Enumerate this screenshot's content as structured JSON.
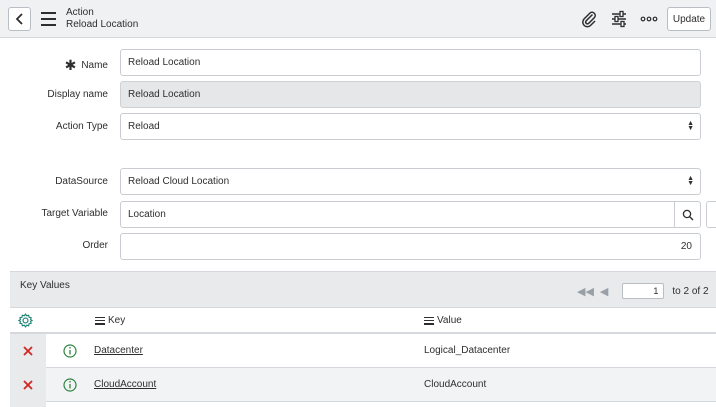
{
  "header": {
    "record_type": "Action",
    "record_name": "Reload Location",
    "update_label": "Update",
    "icons": [
      "back-icon",
      "menu-icon",
      "paperclip-icon",
      "settings-sliders-icon",
      "more-icon"
    ]
  },
  "form": {
    "name": {
      "label": "Name",
      "value": "Reload Location",
      "mandatory_glyph": "✱"
    },
    "display_name": {
      "label": "Display name",
      "value": "Reload Location"
    },
    "action_type": {
      "label": "Action Type",
      "value": "Reload"
    },
    "data_source": {
      "label": "DataSource",
      "value": "Reload Cloud Location"
    },
    "target_variable": {
      "label": "Target Variable",
      "value": "Location"
    },
    "order": {
      "label": "Order",
      "value": "20"
    }
  },
  "related_list": {
    "title": "Key Values",
    "pager": {
      "page": "1",
      "total_text": "to 2 of 2"
    },
    "columns": {
      "key": "Key",
      "value": "Value"
    },
    "rows": [
      {
        "key": "Datacenter",
        "value": "Logical_Datacenter"
      },
      {
        "key": "CloudAccount",
        "value": "CloudAccount"
      }
    ]
  },
  "colors": {
    "delete": "#d0261f",
    "info": "#2e8540",
    "gear": "#1f8476"
  }
}
